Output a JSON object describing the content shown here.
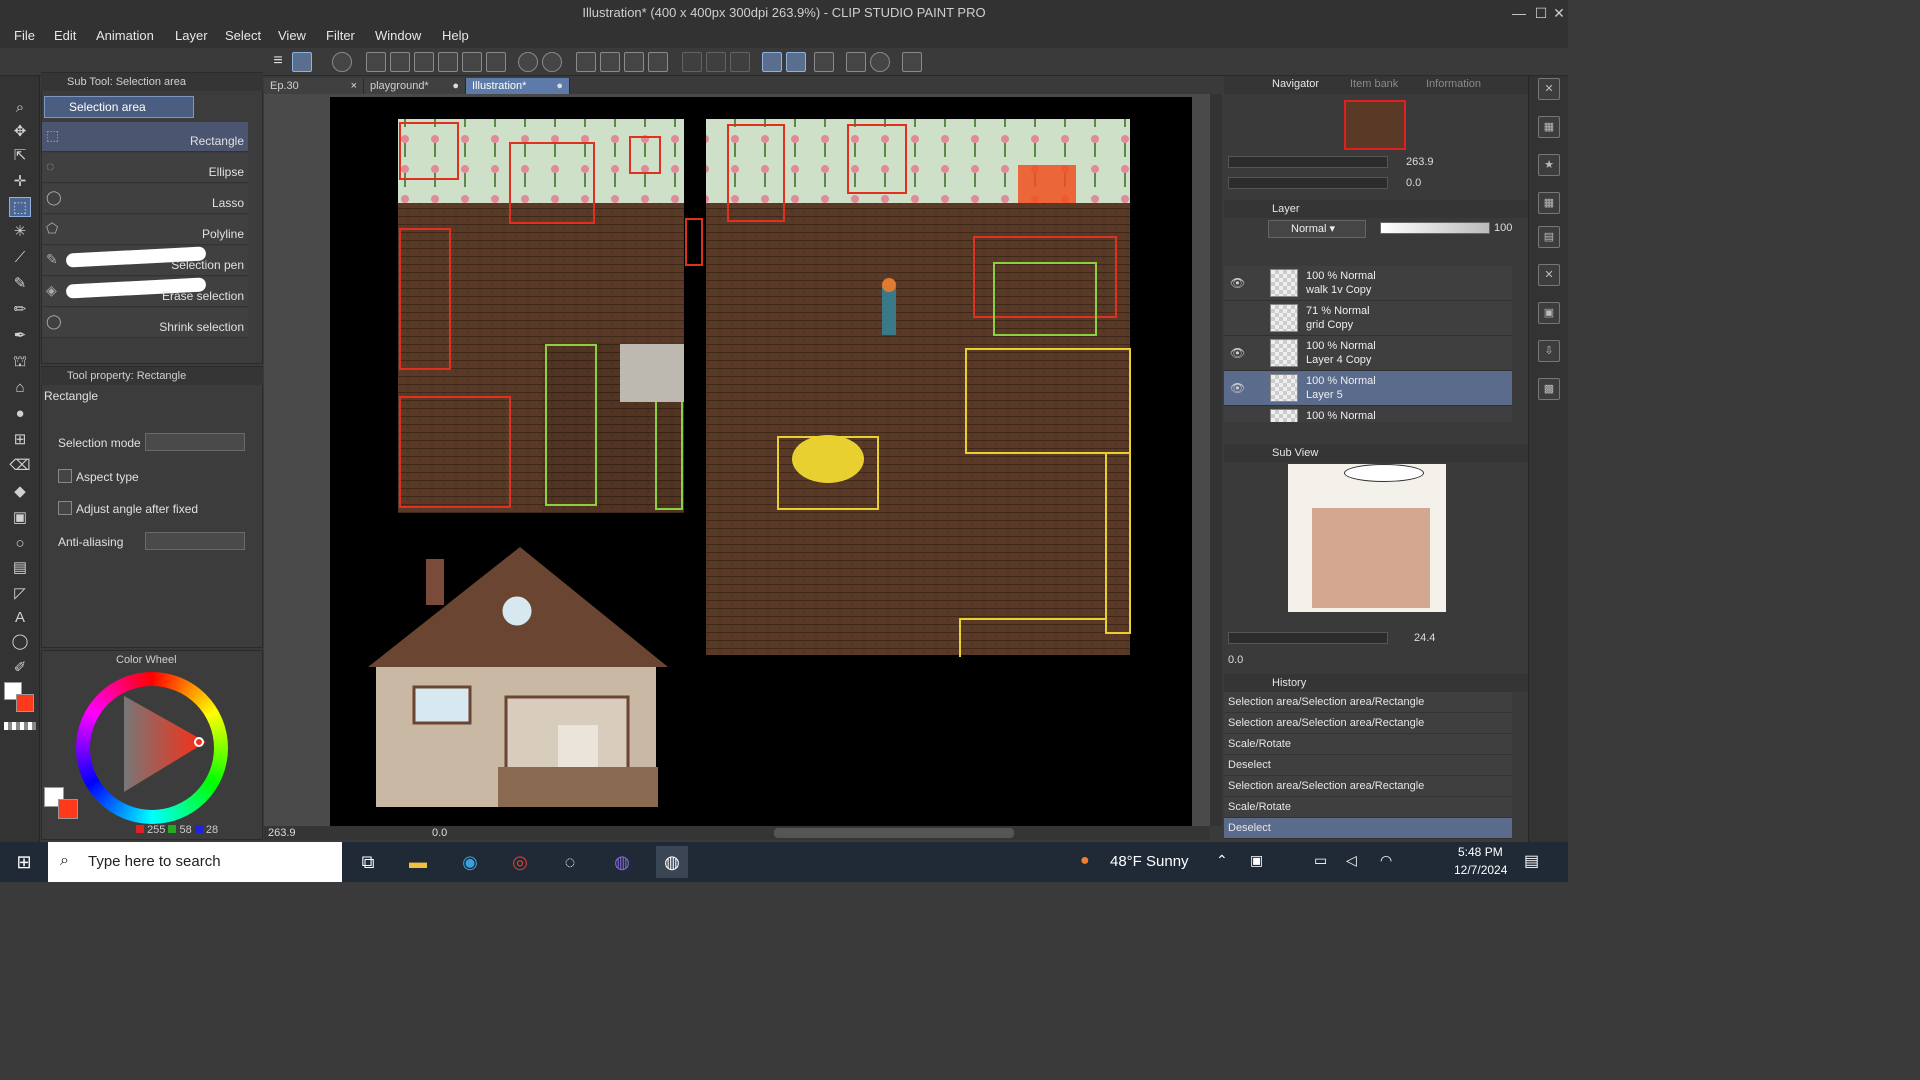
{
  "app": {
    "title": "Illustration* (400 x 400px 300dpi 263.9%)  - CLIP STUDIO PAINT PRO"
  },
  "menu": [
    "File",
    "Edit",
    "Animation",
    "Layer",
    "Select",
    "View",
    "Filter",
    "Window",
    "Help"
  ],
  "subtool": {
    "header": "Sub Tool: Selection area",
    "group": "Selection area",
    "items": [
      "Rectangle",
      "Ellipse",
      "Lasso",
      "Polyline",
      "Selection pen",
      "Erase selection",
      "Shrink selection"
    ],
    "selected": "Rectangle"
  },
  "toolprop": {
    "header": "Tool property: Rectangle",
    "name": "Rectangle",
    "selection_mode_label": "Selection mode",
    "aspect_type_label": "Aspect type",
    "adjust_angle_label": "Adjust angle after fixed",
    "anti_aliasing_label": "Anti-aliasing"
  },
  "color": {
    "header": "Color Wheel",
    "r": "255",
    "g": "58",
    "b": "28",
    "main_color": "#ff3a1c"
  },
  "tabs": [
    {
      "label": "Ep.30",
      "close": "×"
    },
    {
      "label": "playground*",
      "close": "●"
    },
    {
      "label": "Illustration*",
      "close": "●"
    }
  ],
  "canvas_status": {
    "zoom": "263.9",
    "angle": "0.0"
  },
  "navigator": {
    "tabs": [
      "Navigator",
      "Item bank",
      "Information"
    ],
    "zoom": "263.9",
    "angle": "0.0"
  },
  "layer": {
    "header": "Layer",
    "blend": "Normal",
    "opacity": "100",
    "rows": [
      {
        "l1": "100 % Normal",
        "l2": "walk 1v Copy",
        "visible": true
      },
      {
        "l1": "71 % Normal",
        "l2": "grid Copy",
        "visible": false
      },
      {
        "l1": "100 % Normal",
        "l2": "Layer 4 Copy",
        "visible": true
      },
      {
        "l1": "100 % Normal",
        "l2": "Layer 5",
        "visible": true
      },
      {
        "l1": "100 % Normal",
        "l2": "",
        "visible": true
      }
    ]
  },
  "subview": {
    "header": "Sub View",
    "zoom": "24.4",
    "angle": "0.0"
  },
  "history": {
    "header": "History",
    "items": [
      "Selection area/Selection area/Rectangle",
      "Selection area/Selection area/Rectangle",
      "Scale/Rotate",
      "Deselect",
      "Selection area/Selection area/Rectangle",
      "Scale/Rotate",
      "Deselect"
    ]
  },
  "taskbar": {
    "search_placeholder": "Type here to search",
    "weather": "48°F  Sunny",
    "time": "5:48 PM",
    "date": "12/7/2024"
  }
}
